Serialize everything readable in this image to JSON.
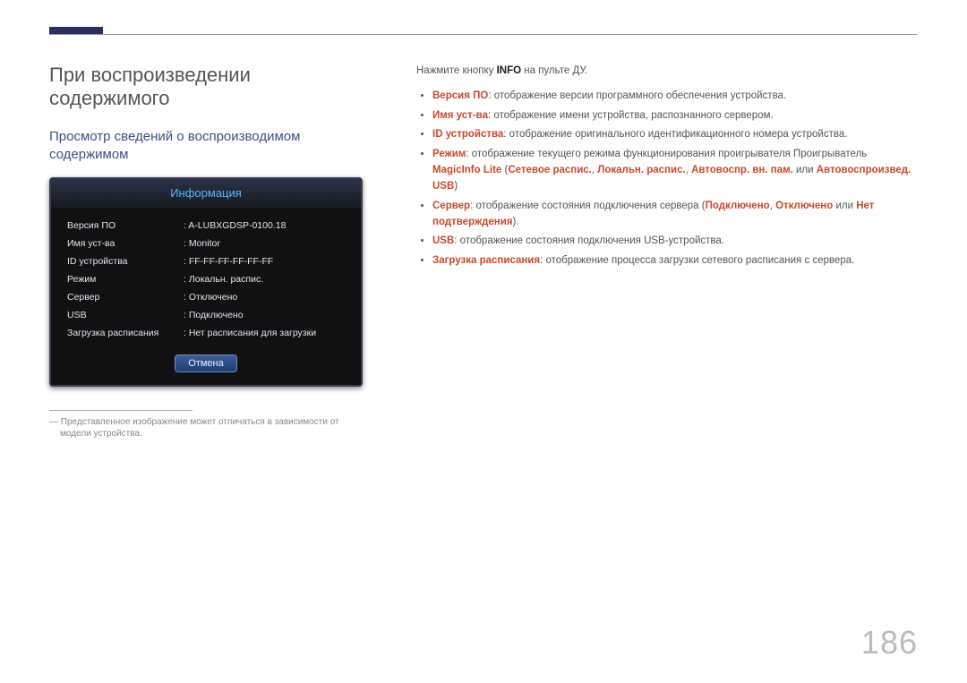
{
  "page_number": "186",
  "headings": {
    "section_title": "При воспроизведении содержимого",
    "subsection_title": "Просмотр сведений о воспроизводимом содержимом"
  },
  "info_panel": {
    "title": "Информация",
    "rows": [
      {
        "label": "Версия ПО",
        "value": "A-LUBXGDSP-0100.18"
      },
      {
        "label": "Имя уст-ва",
        "value": "Monitor"
      },
      {
        "label": "ID устройства",
        "value": "FF-FF-FF-FF-FF-FF"
      },
      {
        "label": "Режим",
        "value": "Локальн. распис."
      },
      {
        "label": "Сервер",
        "value": "Отключено"
      },
      {
        "label": "USB",
        "value": "Подключено"
      },
      {
        "label": "Загрузка расписания",
        "value": "Нет расписания для загрузки"
      }
    ],
    "cancel": "Отмена"
  },
  "footnote": "― Представленное изображение может отличаться в зависимости от модели устройства.",
  "intro": {
    "prefix": "Нажмите кнопку ",
    "bold": "INFO",
    "suffix": " на пульте ДУ."
  },
  "bullets": [
    {
      "key": "Версия ПО",
      "plain": ": отображение версии программного обеспечения устройства."
    },
    {
      "key": "Имя уст-ва",
      "plain": ": отображение имени устройства, распознанного сервером."
    },
    {
      "key": "ID устройства",
      "plain": ": отображение оригинального идентификационного номера устройства."
    },
    {
      "key": "Режим",
      "plain_before_inline": ": отображение текущего режима функционирования проигрывателя Проигрыватель ",
      "inline1": "MagicInfo Lite",
      "between1": " (",
      "inline2": "Сетевое распис.",
      "between2": ", ",
      "inline3": "Локальн. распис.",
      "between3": ", ",
      "inline4": "Автовоспр. вн. пам.",
      "between4": " или ",
      "inline5": "Автовоспроизвед. USB",
      "after": ")"
    },
    {
      "key": "Сервер",
      "plain_before_inline": ": отображение состояния подключения сервера (",
      "inline1": "Подключено",
      "between1": ", ",
      "inline2": "Отключено",
      "between2": " или ",
      "inline3": "Нет подтверждения",
      "after": ")."
    },
    {
      "key": "USB",
      "plain": ": отображение состояния подключения USB-устройства."
    },
    {
      "key": "Загрузка расписания",
      "plain": ": отображение процесса загрузки сетевого расписания с сервера."
    }
  ]
}
